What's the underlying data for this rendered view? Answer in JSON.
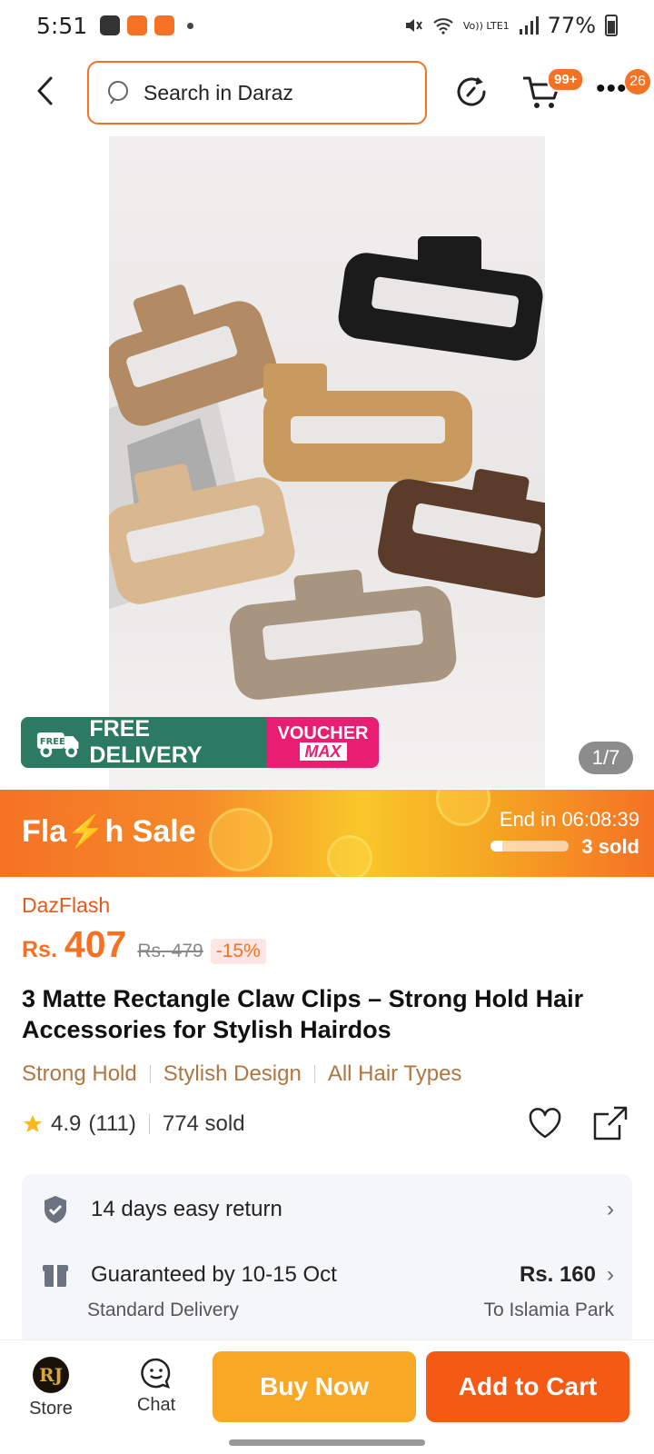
{
  "status": {
    "time": "5:51",
    "network": "Vo)) LTE1",
    "battery": "77%"
  },
  "header": {
    "search_placeholder": "Search in Daraz",
    "cart_badge": "99+",
    "more_badge": "26"
  },
  "gallery": {
    "counter": "1/7",
    "promo_free": "FREE DELIVERY",
    "promo_free_icon_text": "FREE",
    "promo_voucher_top": "VOUCHER",
    "promo_voucher_bottom": "MAX"
  },
  "flash": {
    "title": "Fla⚡h Sale",
    "end_label": "End in",
    "end_time": "06:08:39",
    "sold": "3 sold",
    "progress_fraction": 0.15
  },
  "price": {
    "label": "DazFlash",
    "currency": "Rs.",
    "value": "407",
    "old": "Rs. 479",
    "discount": "-15%"
  },
  "product": {
    "title": "3 Matte Rectangle Claw Clips – Strong Hold Hair Accessories for Stylish Hairdos",
    "tags": [
      "Strong Hold",
      "Stylish Design",
      "All Hair Types"
    ],
    "rating": "4.9",
    "reviews": "(111)",
    "sold": "774 sold"
  },
  "service": {
    "return_text": "14 days easy return",
    "delivery_text": "Guaranteed by 10-15 Oct",
    "delivery_type": "Standard Delivery",
    "delivery_price": "Rs. 160",
    "delivery_to": "To Islamia Park"
  },
  "bottom": {
    "store_label": "Store",
    "store_logo": "RJ",
    "chat_label": "Chat",
    "buy_now": "Buy Now",
    "add_to_cart": "Add to Cart"
  },
  "colors": {
    "accent": "#f57224",
    "buy_now": "#f9a825",
    "add_to_cart": "#f55a14",
    "tag": "#b07642"
  }
}
